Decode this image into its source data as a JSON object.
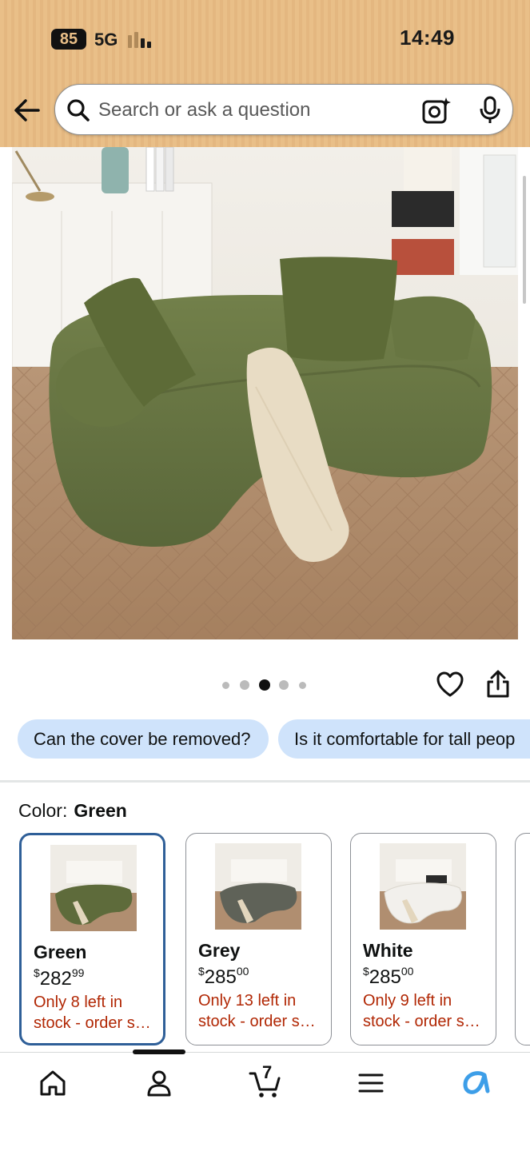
{
  "status_bar": {
    "battery": "85",
    "network": "5G",
    "time": "14:49"
  },
  "search": {
    "placeholder": "Search or ask a question"
  },
  "gallery": {
    "image_count": 5,
    "active_index": 2
  },
  "suggested_questions": [
    "Can the cover be removed?",
    "Is it comfortable for tall peop"
  ],
  "color_selector": {
    "label": "Color:",
    "selected": "Green",
    "options": [
      {
        "name": "Green",
        "currency": "$",
        "price_whole": "282",
        "price_fraction": "99",
        "stock_line1": "Only 8 left in",
        "stock_line2": "stock - order soon."
      },
      {
        "name": "Grey",
        "currency": "$",
        "price_whole": "285",
        "price_fraction": "00",
        "stock_line1": "Only 13 left in",
        "stock_line2": "stock - order soon."
      },
      {
        "name": "White",
        "currency": "$",
        "price_whole": "285",
        "price_fraction": "00",
        "stock_line1": "Only 9 left in",
        "stock_line2": "stock - order soon."
      }
    ]
  },
  "bottom_nav": {
    "cart_count": "7",
    "items": [
      "home-icon",
      "account-icon",
      "cart-icon",
      "menu-icon",
      "rufus-icon"
    ]
  },
  "colors": {
    "header": "#e9bf88",
    "chip": "#cfe3fb",
    "selected_border": "#2f5f98",
    "stock": "#b12704",
    "rufus": "#3d9ee8"
  }
}
